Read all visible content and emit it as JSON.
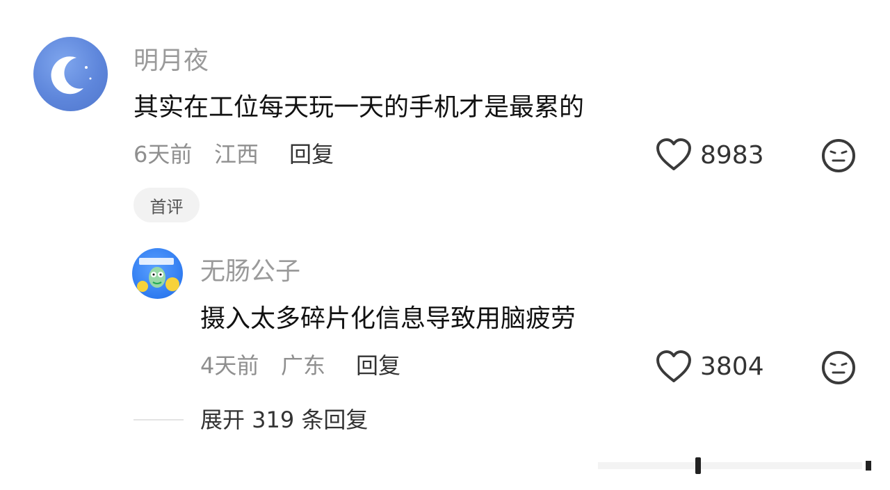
{
  "comments": [
    {
      "username": "明月夜",
      "text": "其实在工位每天玩一天的手机才是最累的",
      "time": "6天前",
      "location": "江西",
      "reply_label": "回复",
      "likes": "8983",
      "tag": "首评"
    },
    {
      "username": "无肠公子",
      "text": "摄入太多碎片化信息导致用脑疲劳",
      "time": "4天前",
      "location": "广东",
      "reply_label": "回复",
      "likes": "3804"
    }
  ],
  "expand_label": "展开 319 条回复",
  "icons": {
    "like": "heart-outline-icon",
    "dislike": "face-emoji-icon"
  },
  "colors": {
    "username": "#9a9a9a",
    "meta": "#8f8f8f",
    "text": "#111111"
  }
}
